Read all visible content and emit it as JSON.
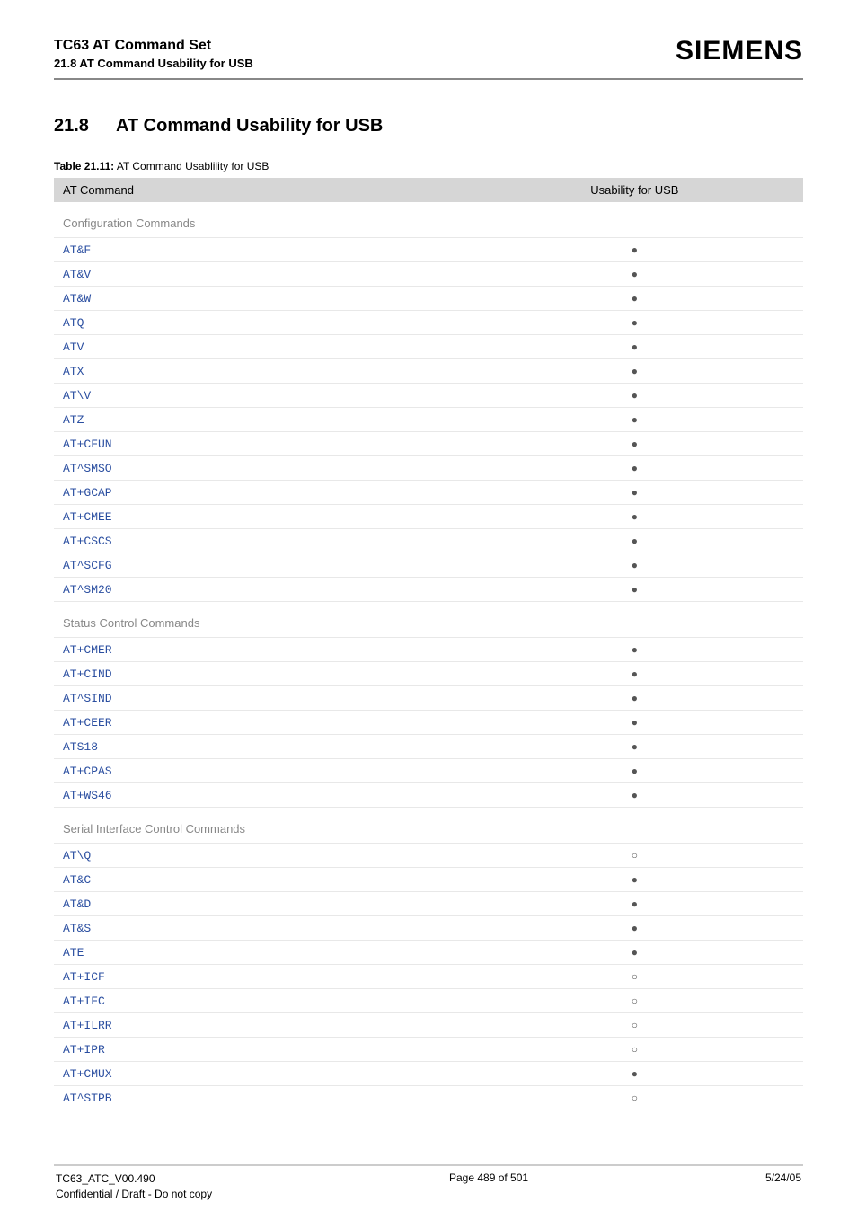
{
  "header": {
    "title": "TC63 AT Command Set",
    "subtitle": "21.8 AT Command Usability for USB",
    "brand": "SIEMENS"
  },
  "section": {
    "number": "21.8",
    "title": "AT Command Usability for USB"
  },
  "table_caption": {
    "label": "Table 21.11:",
    "text": "AT Command Usablility for USB"
  },
  "columns": {
    "cmd": "AT Command",
    "usb": "Usability for USB"
  },
  "groups": [
    {
      "name": "Configuration Commands",
      "rows": [
        {
          "cmd": "AT&F",
          "usb": "filled"
        },
        {
          "cmd": "AT&V",
          "usb": "filled"
        },
        {
          "cmd": "AT&W",
          "usb": "filled"
        },
        {
          "cmd": "ATQ",
          "usb": "filled"
        },
        {
          "cmd": "ATV",
          "usb": "filled"
        },
        {
          "cmd": "ATX",
          "usb": "filled"
        },
        {
          "cmd": "AT\\V",
          "usb": "filled"
        },
        {
          "cmd": "ATZ",
          "usb": "filled"
        },
        {
          "cmd": "AT+CFUN",
          "usb": "filled"
        },
        {
          "cmd": "AT^SMSO",
          "usb": "filled"
        },
        {
          "cmd": "AT+GCAP",
          "usb": "filled"
        },
        {
          "cmd": "AT+CMEE",
          "usb": "filled"
        },
        {
          "cmd": "AT+CSCS",
          "usb": "filled"
        },
        {
          "cmd": "AT^SCFG",
          "usb": "filled"
        },
        {
          "cmd": "AT^SM20",
          "usb": "filled"
        }
      ]
    },
    {
      "name": "Status Control Commands",
      "rows": [
        {
          "cmd": "AT+CMER",
          "usb": "filled"
        },
        {
          "cmd": "AT+CIND",
          "usb": "filled"
        },
        {
          "cmd": "AT^SIND",
          "usb": "filled"
        },
        {
          "cmd": "AT+CEER",
          "usb": "filled"
        },
        {
          "cmd": "ATS18",
          "usb": "filled"
        },
        {
          "cmd": "AT+CPAS",
          "usb": "filled"
        },
        {
          "cmd": "AT+WS46",
          "usb": "filled"
        }
      ]
    },
    {
      "name": "Serial Interface Control Commands",
      "rows": [
        {
          "cmd": "AT\\Q",
          "usb": "empty"
        },
        {
          "cmd": "AT&C",
          "usb": "filled"
        },
        {
          "cmd": "AT&D",
          "usb": "filled"
        },
        {
          "cmd": "AT&S",
          "usb": "filled"
        },
        {
          "cmd": "ATE",
          "usb": "filled"
        },
        {
          "cmd": "AT+ICF",
          "usb": "empty"
        },
        {
          "cmd": "AT+IFC",
          "usb": "empty"
        },
        {
          "cmd": "AT+ILRR",
          "usb": "empty"
        },
        {
          "cmd": "AT+IPR",
          "usb": "empty"
        },
        {
          "cmd": "AT+CMUX",
          "usb": "filled"
        },
        {
          "cmd": "AT^STPB",
          "usb": "empty"
        }
      ]
    }
  ],
  "symbols": {
    "filled": "●",
    "empty": "○"
  },
  "footer": {
    "left_line1": "TC63_ATC_V00.490",
    "left_line2": "Confidential / Draft - Do not copy",
    "center": "Page 489 of 501",
    "right": "5/24/05"
  }
}
